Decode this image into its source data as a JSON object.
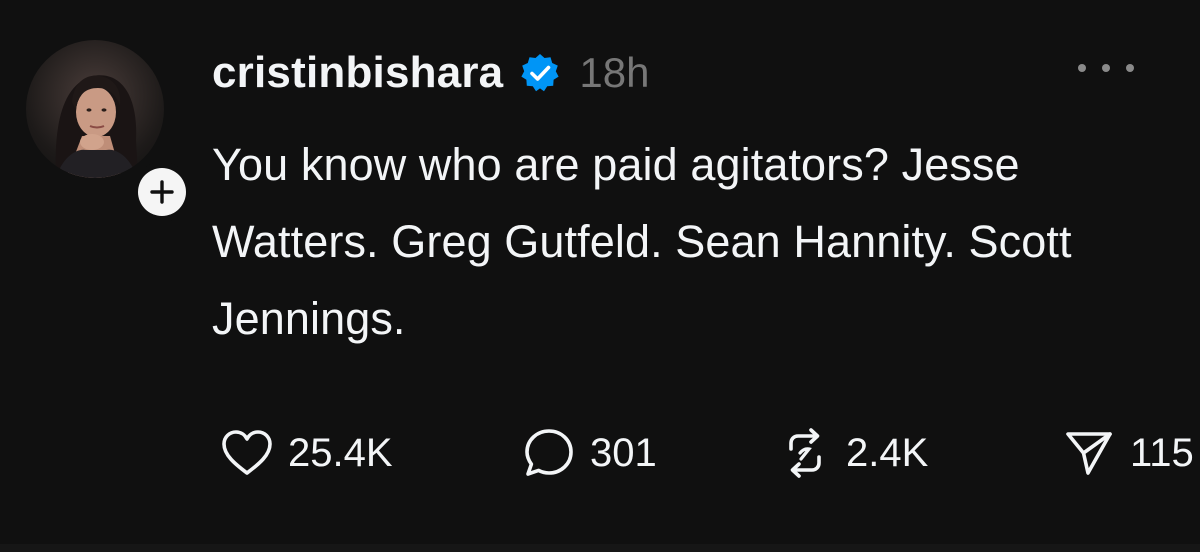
{
  "post": {
    "author": {
      "username": "cristinbishara",
      "verified_icon": "verified-badge-icon",
      "avatar": "profile-photo"
    },
    "timestamp": "18h",
    "more_icon": "more-options-icon",
    "follow_icon": "plus-icon",
    "text": "You know who are paid agitators? Jesse Watters. Greg Gutfeld. Sean Hannity. Scott Jennings.",
    "actions": {
      "like": {
        "icon": "heart-icon",
        "count": "25.4K"
      },
      "reply": {
        "icon": "speech-bubble-icon",
        "count": "301"
      },
      "repost": {
        "icon": "repost-icon",
        "count": "2.4K"
      },
      "share": {
        "icon": "send-icon",
        "count": "115"
      }
    }
  },
  "colors": {
    "background": "#101010",
    "text": "#f3f5f7",
    "muted": "#777777",
    "verified": "#0095f6"
  }
}
